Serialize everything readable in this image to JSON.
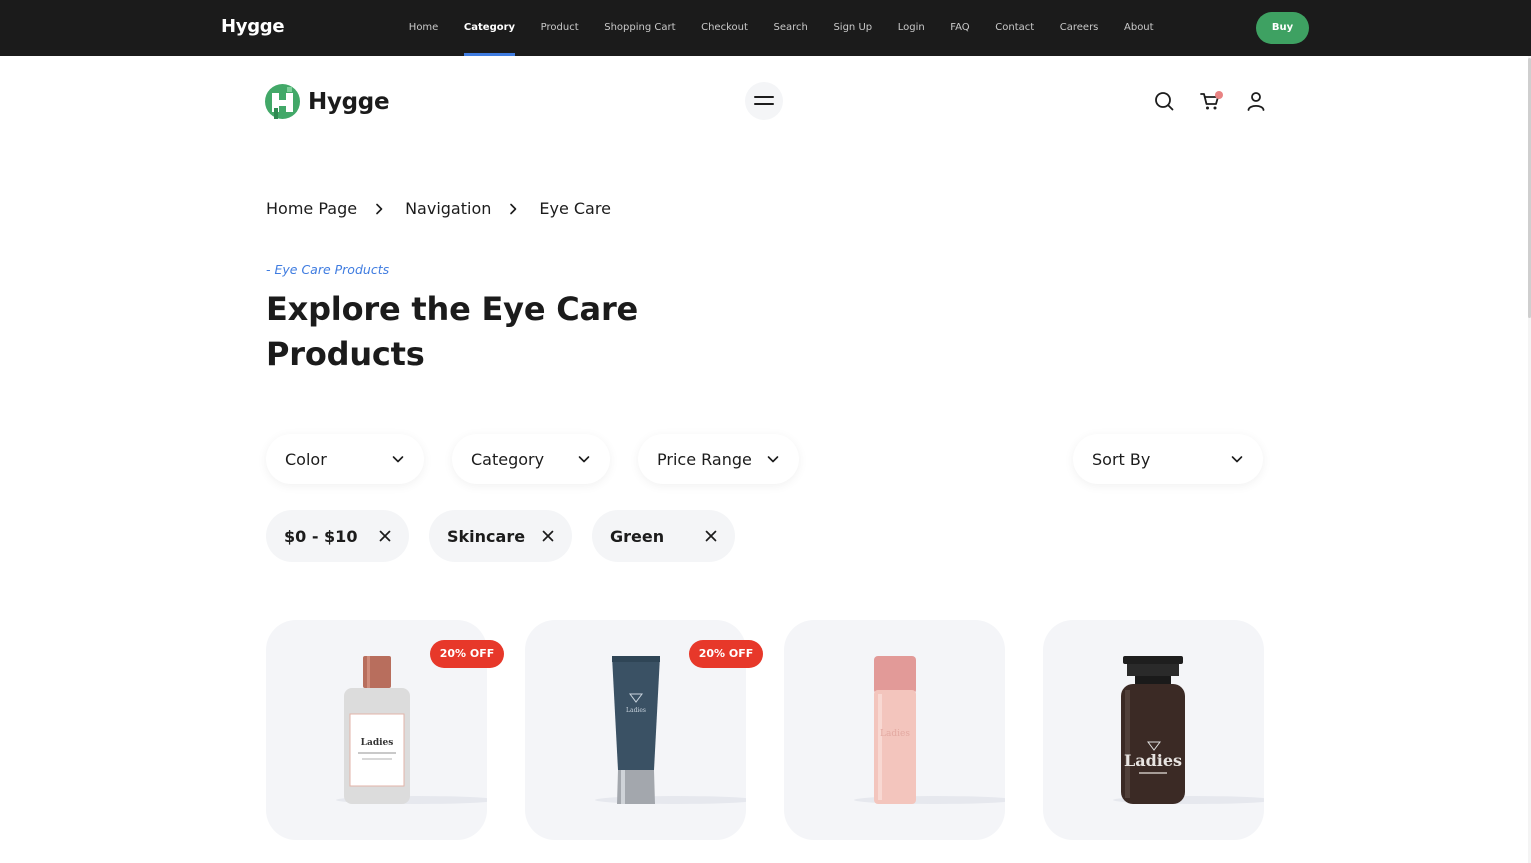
{
  "topbar": {
    "brand": "Hygge",
    "nav": [
      "Home",
      "Category",
      "Product",
      "Shopping Cart",
      "Checkout",
      "Search",
      "Sign Up",
      "Login",
      "FAQ",
      "Contact",
      "Careers",
      "About"
    ],
    "active": "Category",
    "buy_label": "Buy"
  },
  "header": {
    "logo_text": "Hygge",
    "icons": [
      "menu-icon",
      "search-icon",
      "cart-icon",
      "user-icon"
    ]
  },
  "breadcrumb": [
    "Home Page",
    "Navigation",
    "Eye Care"
  ],
  "hero": {
    "eyebrow": "- Eye Care Products",
    "title": "Explore the Eye Care Products"
  },
  "filters": {
    "color": "Color",
    "category": "Category",
    "price": "Price Range",
    "sort": "Sort By"
  },
  "chips": [
    "$0 - $10",
    "Skincare",
    "Green"
  ],
  "products": [
    {
      "badge": "20% OFF",
      "label": "Ladies"
    },
    {
      "badge": "20% OFF",
      "label": "Ladies"
    },
    {
      "badge": "",
      "label": "Ladies"
    },
    {
      "badge": "",
      "label": "Ladies"
    }
  ],
  "colors": {
    "accent_blue": "#3f7ce0",
    "buy_green": "#3ea162",
    "badge_red": "#e7382a",
    "topbar_bg": "#1b1b1b"
  }
}
